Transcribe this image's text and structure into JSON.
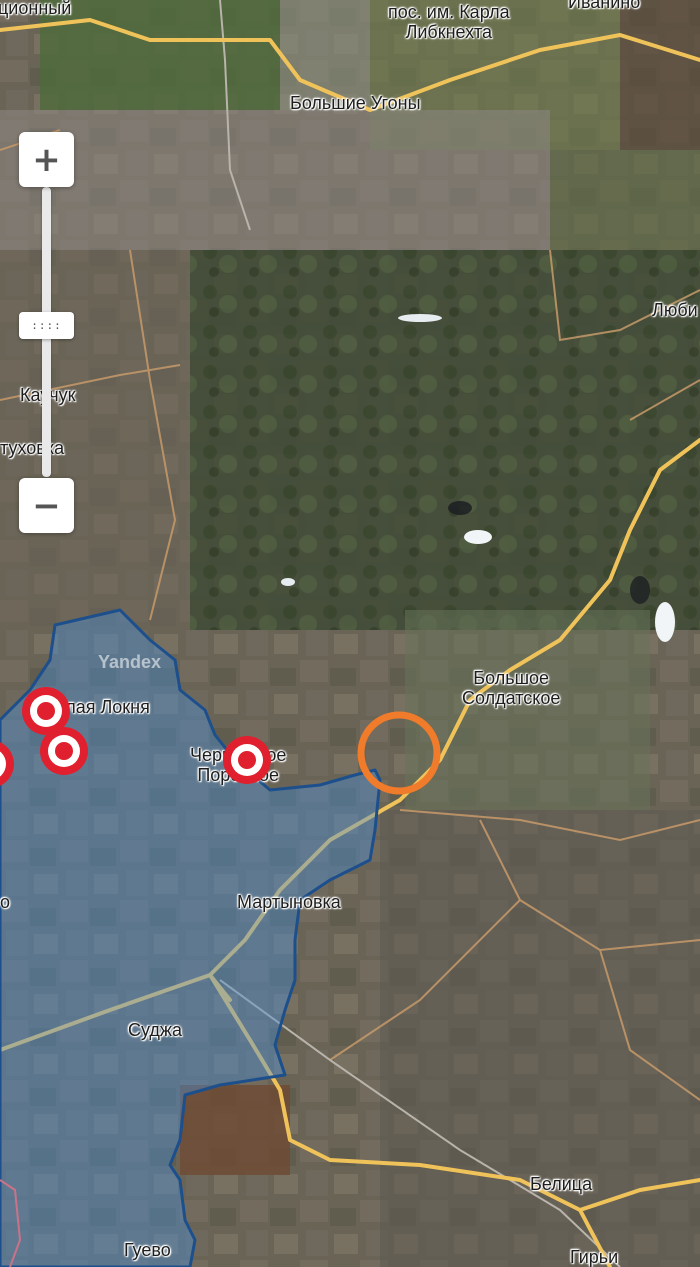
{
  "map": {
    "watermark": "Yandex",
    "colors": {
      "controlled_area_fill": "#4a90d9",
      "controlled_area_border": "#1c4f8c",
      "road_major": "#f0c35a",
      "road_minor": "#c79a6a",
      "marker_red": "#e0202e",
      "highlight_circle": "#f07b2a"
    },
    "labels": [
      {
        "id": "konstitutsionny",
        "text": "ционный"
      },
      {
        "id": "karla-libknekhta",
        "text": "пос. им. Карла\nЛибкнехта"
      },
      {
        "id": "ivanino",
        "text": "Иванино"
      },
      {
        "id": "bolshie-ugony",
        "text": "Большие Угоны"
      },
      {
        "id": "lyubimovka",
        "text": "Люби"
      },
      {
        "id": "kauchuk",
        "text": "Каучук"
      },
      {
        "id": "tukhovka",
        "text": "туховка"
      },
      {
        "id": "lokinya",
        "text": "Малая Локня"
      },
      {
        "id": "cherkasskoe-porechnoe",
        "text": "Черкасское\nПоречное"
      },
      {
        "id": "bolshoe-soldatskoe",
        "text": "Большое\nСолдатское"
      },
      {
        "id": "martynovka",
        "text": "Мартыновка"
      },
      {
        "id": "sudzha",
        "text": "Суджа"
      },
      {
        "id": "belitsa",
        "text": "Белица"
      },
      {
        "id": "guevo",
        "text": "Гуево"
      },
      {
        "id": "giri",
        "text": "Гирьи"
      },
      {
        "id": "left-edge",
        "text": "о"
      }
    ],
    "markers": [
      {
        "id": "marker-1",
        "icon": "target-marker-icon"
      },
      {
        "id": "marker-2",
        "icon": "target-marker-icon"
      },
      {
        "id": "marker-3",
        "icon": "target-marker-icon"
      },
      {
        "id": "marker-4",
        "icon": "target-marker-icon"
      }
    ],
    "highlight": {
      "icon": "orange-circle-icon"
    }
  },
  "controls": {
    "zoom_in_label": "+",
    "zoom_out_label": "−",
    "zoom_handle_label": "::::"
  }
}
